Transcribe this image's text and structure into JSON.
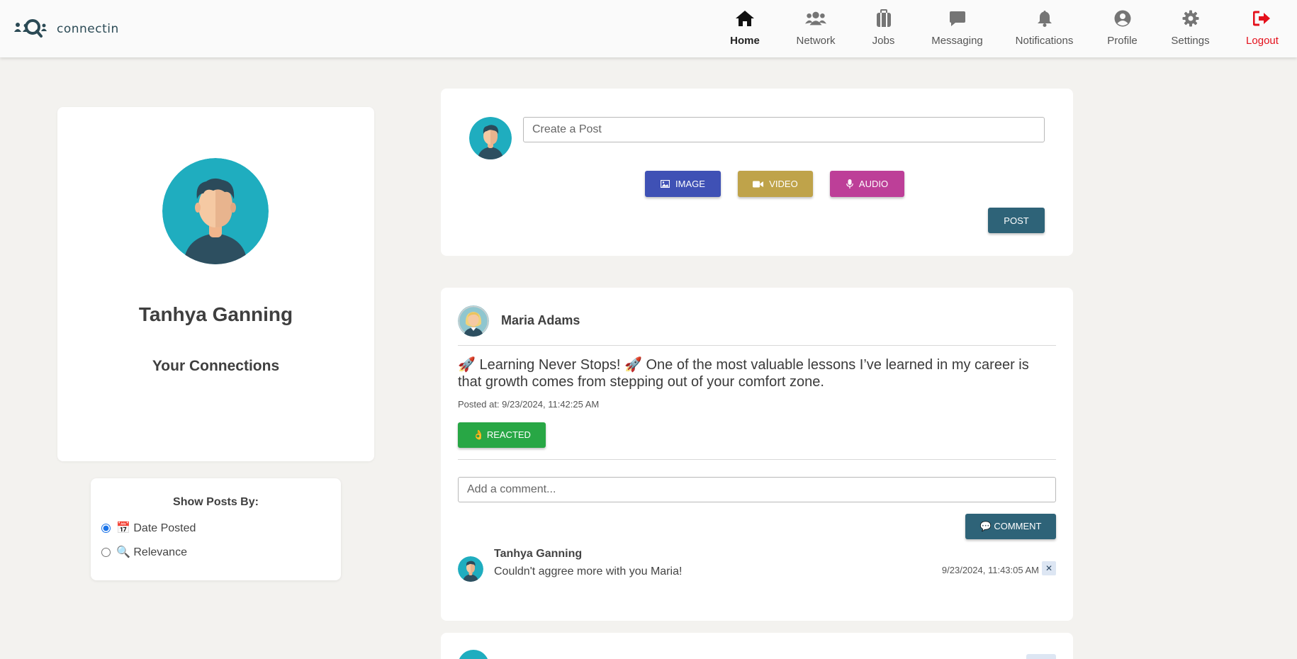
{
  "app": {
    "name": "connectin"
  },
  "nav": {
    "items": [
      {
        "label": "Home",
        "icon": "home-icon",
        "active": true
      },
      {
        "label": "Network",
        "icon": "users-icon"
      },
      {
        "label": "Jobs",
        "icon": "briefcase-icon"
      },
      {
        "label": "Messaging",
        "icon": "chat-icon"
      },
      {
        "label": "Notifications",
        "icon": "bell-icon"
      },
      {
        "label": "Profile",
        "icon": "user-circle-icon"
      },
      {
        "label": "Settings",
        "icon": "gear-icon"
      },
      {
        "label": "Logout",
        "icon": "logout-icon",
        "color": "#e4101b"
      }
    ]
  },
  "profile": {
    "name": "Tanhya Ganning",
    "connections_title": "Your Connections"
  },
  "sort": {
    "title": "Show Posts By:",
    "options": [
      {
        "label": "📅 Date Posted",
        "checked": true
      },
      {
        "label": "🔍 Relevance",
        "checked": false
      }
    ]
  },
  "composer": {
    "placeholder": "Create a Post",
    "image_label": "IMAGE",
    "video_label": "VIDEO",
    "audio_label": "AUDIO",
    "post_label": "POST"
  },
  "post": {
    "author": "Maria Adams",
    "text": "🚀 Learning Never Stops! 🚀 One of the most valuable lessons I’ve learned in my career is that growth comes from stepping out of your comfort zone.",
    "posted_at": "Posted at: 9/23/2024, 11:42:25 AM",
    "react_label": "👌 REACTED",
    "comment_placeholder": "Add a comment...",
    "comment_button": "💬 COMMENT",
    "comments": [
      {
        "author": "Tanhya Ganning",
        "text": "Couldn't aggree more with you Maria!",
        "time": "9/23/2024, 11:43:05 AM",
        "delete_label": "✕"
      }
    ]
  },
  "colors": {
    "accent": "#2e6378",
    "image_btn": "#3f51b5",
    "video_btn": "#bfa34a",
    "audio_btn": "#bd3f98",
    "reacted_btn": "#28a745",
    "avatar_bg": "#1fadbf"
  }
}
